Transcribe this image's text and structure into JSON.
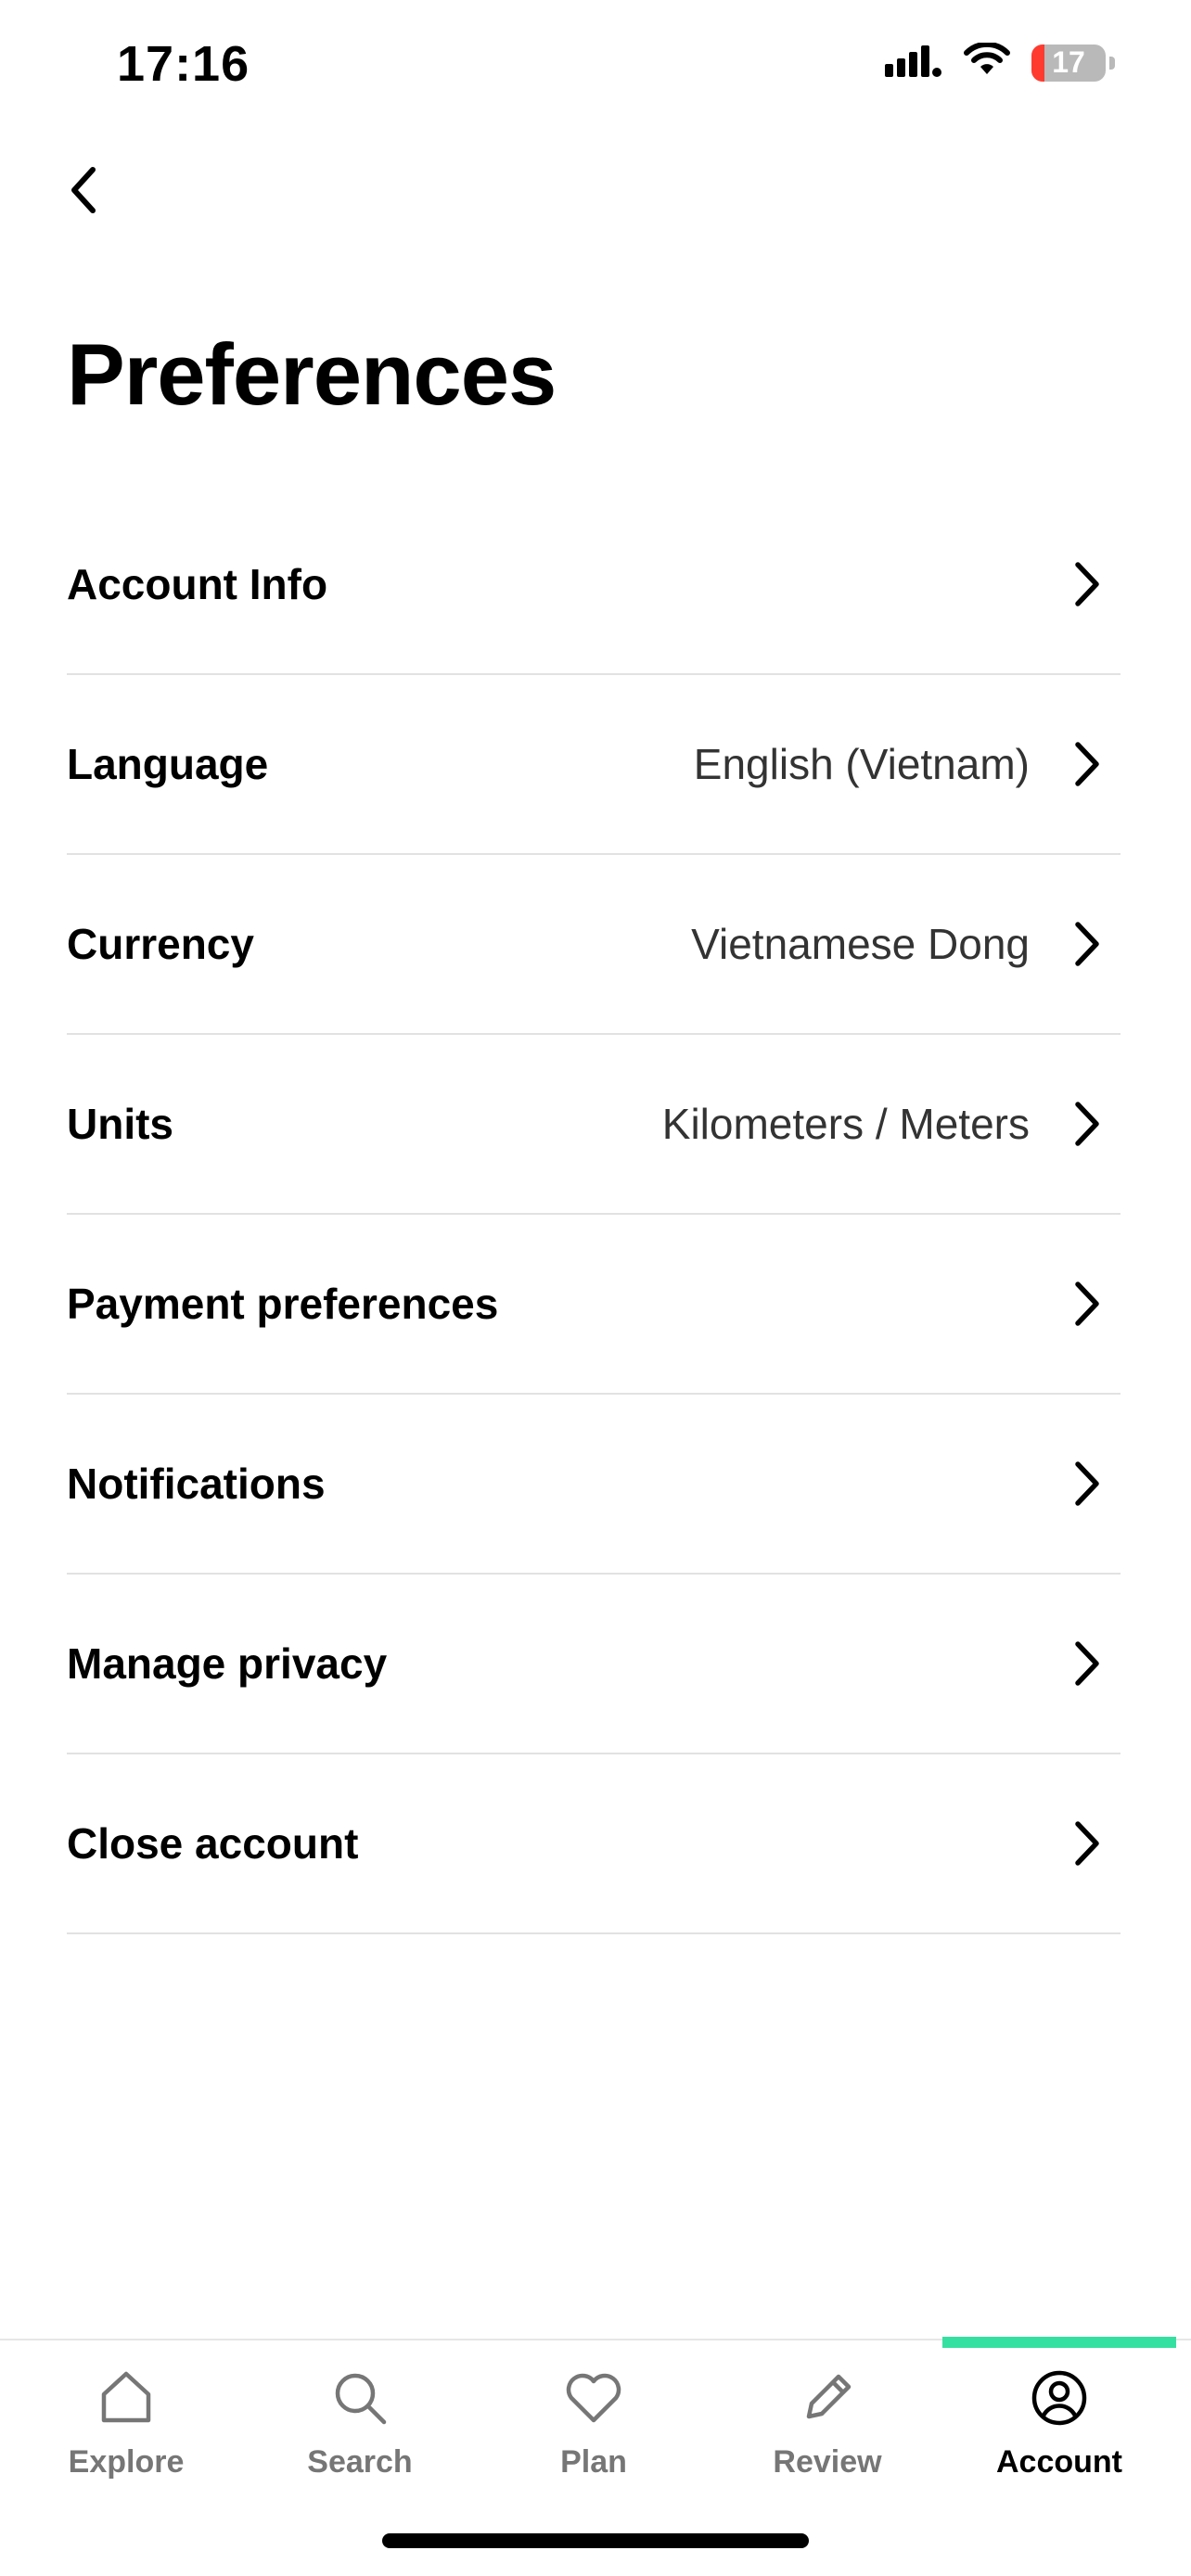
{
  "status_bar": {
    "time": "17:16",
    "battery_level": "17",
    "battery_fraction": 0.17,
    "icons": [
      "cellular-signal-icon",
      "wifi-icon",
      "battery-icon"
    ]
  },
  "header": {
    "back_icon": "chevron-left-icon",
    "title": "Preferences"
  },
  "settings": [
    {
      "label": "Account Info",
      "value": ""
    },
    {
      "label": "Language",
      "value": "English (Vietnam)"
    },
    {
      "label": "Currency",
      "value": "Vietnamese Dong"
    },
    {
      "label": "Units",
      "value": "Kilometers / Meters"
    },
    {
      "label": "Payment preferences",
      "value": ""
    },
    {
      "label": "Notifications",
      "value": ""
    },
    {
      "label": "Manage privacy",
      "value": ""
    },
    {
      "label": "Close account",
      "value": ""
    }
  ],
  "tab_bar": {
    "active_tab": "Account",
    "accent_color": "#34e0a1",
    "tabs": [
      {
        "label": "Explore",
        "icon": "home-icon"
      },
      {
        "label": "Search",
        "icon": "search-icon"
      },
      {
        "label": "Plan",
        "icon": "heart-icon"
      },
      {
        "label": "Review",
        "icon": "pencil-icon"
      },
      {
        "label": "Account",
        "icon": "account-icon"
      }
    ]
  }
}
